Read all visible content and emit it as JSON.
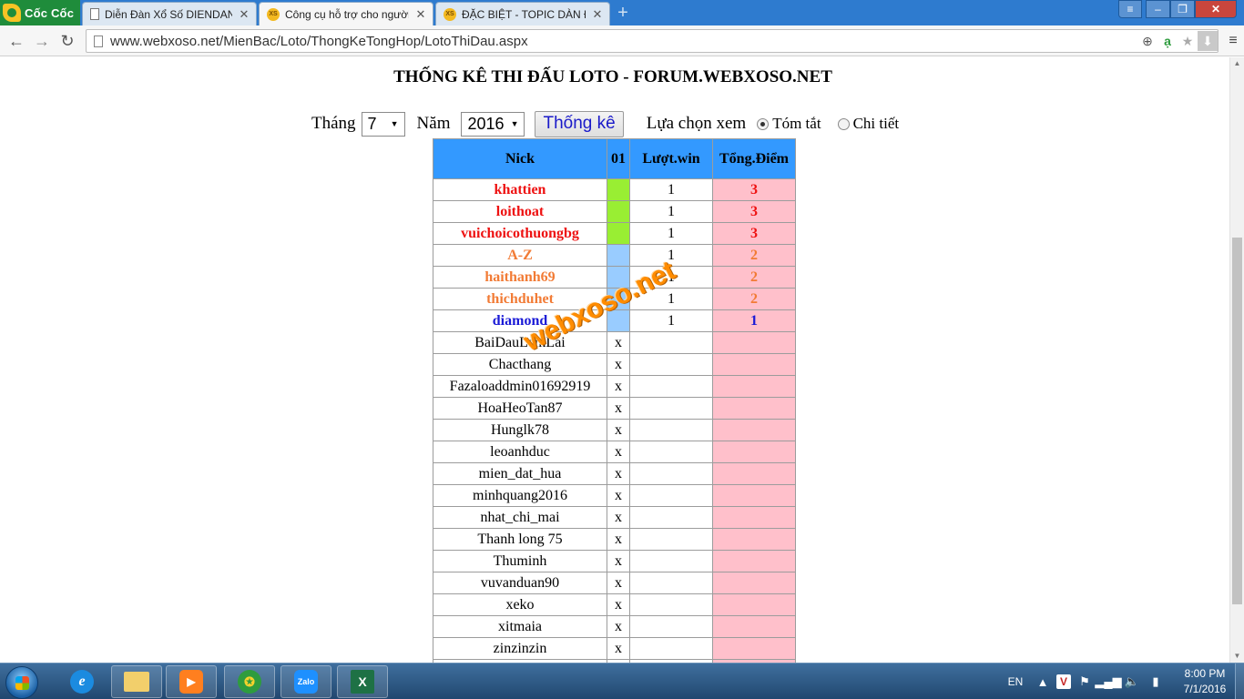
{
  "browser": {
    "brand": "Cốc Cốc",
    "tabs": [
      {
        "title": "Diễn Đàn Xổ Số DIENDAN",
        "icon": "page-icon",
        "active": false
      },
      {
        "title": "Công cụ hỗ trợ cho người",
        "icon": "xs-site-icon",
        "active": true
      },
      {
        "title": "ĐẶC BIỆT - TOPIC DÀN Đ",
        "icon": "xs-site-icon",
        "active": false
      }
    ],
    "url": "www.webxoso.net/MienBac/Loto/ThongKeTongHop/LotoThiDau.aspx"
  },
  "page": {
    "title": "THỐNG KÊ THI ĐẤU LOTO - FORUM.WEBXOSO.NET",
    "filters": {
      "month_label": "Tháng",
      "month_value": "7",
      "year_label": "Năm",
      "year_value": "2016",
      "submit_label": "Thống kê",
      "view_label": "Lựa chọn xem",
      "option_summary": "Tóm tắt",
      "option_detail": "Chi tiết",
      "selected_view": "Tóm tắt"
    },
    "table": {
      "headers": {
        "nick": "Nick",
        "day": "01",
        "wins": "Lượt.win",
        "points": "Tổng.Điểm"
      },
      "rows": [
        {
          "nick": "khattien",
          "day": "",
          "day_color": "#99ee33",
          "wins": "1",
          "points": "3",
          "color": "#ee1111",
          "bold": true
        },
        {
          "nick": "loithoat",
          "day": "",
          "day_color": "#99ee33",
          "wins": "1",
          "points": "3",
          "color": "#ee1111",
          "bold": true
        },
        {
          "nick": "vuichoicothuongbg",
          "day": "",
          "day_color": "#99ee33",
          "wins": "1",
          "points": "3",
          "color": "#ee1111",
          "bold": true
        },
        {
          "nick": "A-Z",
          "day": "",
          "day_color": "#99ccff",
          "wins": "1",
          "points": "2",
          "color": "#f27b35",
          "bold": true
        },
        {
          "nick": "haithanh69",
          "day": "",
          "day_color": "#99ccff",
          "wins": "1",
          "points": "2",
          "color": "#f27b35",
          "bold": true
        },
        {
          "nick": "thichduhet",
          "day": "",
          "day_color": "#99ccff",
          "wins": "1",
          "points": "2",
          "color": "#f27b35",
          "bold": true
        },
        {
          "nick": "diamond",
          "day": "",
          "day_color": "#99ccff",
          "wins": "1",
          "points": "1",
          "color": "#1a1ad6",
          "bold": true
        },
        {
          "nick": "BaiDauLamLai",
          "day": "x",
          "day_color": "",
          "wins": "",
          "points": "",
          "color": "#000000",
          "bold": false
        },
        {
          "nick": "Chacthang",
          "day": "x",
          "day_color": "",
          "wins": "",
          "points": "",
          "color": "#000000",
          "bold": false
        },
        {
          "nick": "Fazaloaddmin01692919",
          "day": "x",
          "day_color": "",
          "wins": "",
          "points": "",
          "color": "#000000",
          "bold": false
        },
        {
          "nick": "HoaHeoTan87",
          "day": "x",
          "day_color": "",
          "wins": "",
          "points": "",
          "color": "#000000",
          "bold": false
        },
        {
          "nick": "Hunglk78",
          "day": "x",
          "day_color": "",
          "wins": "",
          "points": "",
          "color": "#000000",
          "bold": false
        },
        {
          "nick": "leoanhduc",
          "day": "x",
          "day_color": "",
          "wins": "",
          "points": "",
          "color": "#000000",
          "bold": false
        },
        {
          "nick": "mien_dat_hua",
          "day": "x",
          "day_color": "",
          "wins": "",
          "points": "",
          "color": "#000000",
          "bold": false
        },
        {
          "nick": "minhquang2016",
          "day": "x",
          "day_color": "",
          "wins": "",
          "points": "",
          "color": "#000000",
          "bold": false
        },
        {
          "nick": "nhat_chi_mai",
          "day": "x",
          "day_color": "",
          "wins": "",
          "points": "",
          "color": "#000000",
          "bold": false
        },
        {
          "nick": "Thanh long 75",
          "day": "x",
          "day_color": "",
          "wins": "",
          "points": "",
          "color": "#000000",
          "bold": false
        },
        {
          "nick": "Thuminh",
          "day": "x",
          "day_color": "",
          "wins": "",
          "points": "",
          "color": "#000000",
          "bold": false
        },
        {
          "nick": "vuvanduan90",
          "day": "x",
          "day_color": "",
          "wins": "",
          "points": "",
          "color": "#000000",
          "bold": false
        },
        {
          "nick": "xeko",
          "day": "x",
          "day_color": "",
          "wins": "",
          "points": "",
          "color": "#000000",
          "bold": false
        },
        {
          "nick": "xitmaia",
          "day": "x",
          "day_color": "",
          "wins": "",
          "points": "",
          "color": "#000000",
          "bold": false
        },
        {
          "nick": "zinzinzin",
          "day": "x",
          "day_color": "",
          "wins": "",
          "points": "",
          "color": "#000000",
          "bold": false
        },
        {
          "nick": "",
          "day": "",
          "day_color": "",
          "wins": "",
          "points": "",
          "color": "#000000",
          "bold": false
        }
      ]
    },
    "watermark": "webxoso.net"
  },
  "taskbar": {
    "apps": [
      {
        "name": "internet-explorer",
        "glyph": "e"
      },
      {
        "name": "file-explorer",
        "glyph": ""
      },
      {
        "name": "media-player",
        "glyph": "▶"
      },
      {
        "name": "coccoc-browser",
        "glyph": "✪"
      },
      {
        "name": "zalo",
        "glyph": "Zalo"
      },
      {
        "name": "excel",
        "glyph": "X"
      }
    ],
    "language": "EN",
    "time": "8:00 PM",
    "date": "7/1/2016"
  },
  "colors": {
    "tabbar": "#2e7bcf",
    "header_bg": "#3399ff",
    "points_bg": "#ffc0cb",
    "watermark": "#ff8c00"
  }
}
